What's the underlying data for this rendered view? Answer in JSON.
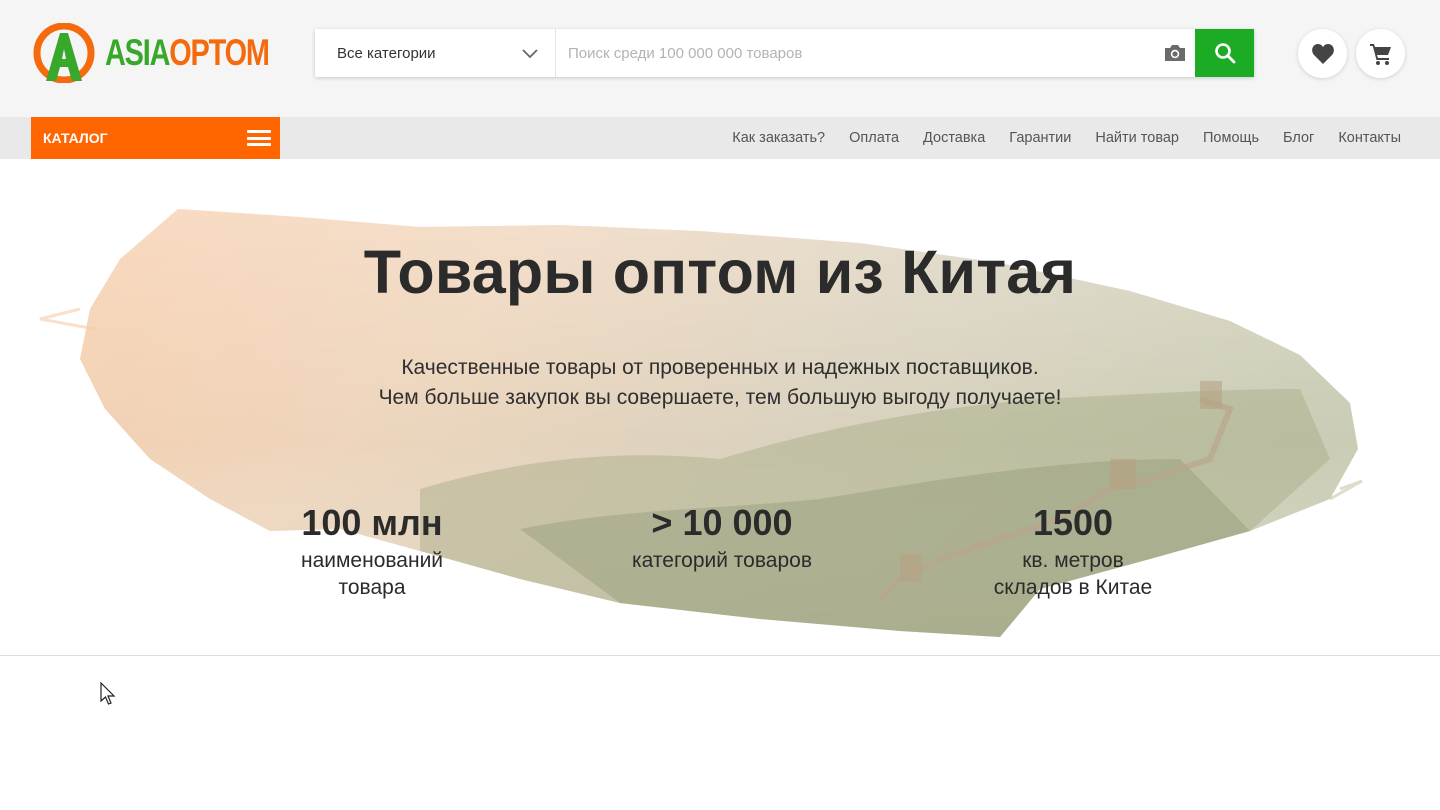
{
  "brand": {
    "part1": "ASIA",
    "part2": "OPTOM",
    "green": "#38a82c",
    "orange": "#f46a0c"
  },
  "search": {
    "category_label": "Все категории",
    "placeholder": "Поиск среди 100 000 000 товаров",
    "button_color": "#1cab24"
  },
  "icons": {
    "camera": "camera-icon",
    "search": "search-icon",
    "favorites": "heart-icon",
    "cart": "shopping-cart-icon",
    "menu": "hamburger-menu-icon",
    "dropdown": "chevron-down-icon"
  },
  "nav": {
    "catalog_label": "КАТАЛОГ",
    "catalog_color": "#ff6600",
    "links": [
      "Как заказать?",
      "Оплата",
      "Доставка",
      "Гарантии",
      "Найти товар",
      "Помощь",
      "Блог",
      "Контакты"
    ]
  },
  "hero": {
    "title": "Товары оптом из Китая",
    "subtitle_line1": "Качественные товары от проверенных и надежных поставщиков.",
    "subtitle_line2": "Чем больше закупок вы совершаете, тем большую выгоду получаете!",
    "stats": [
      {
        "value": "100 млн",
        "caption_line1": "наименований",
        "caption_line2": "товара"
      },
      {
        "value": "> 10 000",
        "caption_line1": "категорий товаров",
        "caption_line2": ""
      },
      {
        "value": "1500",
        "caption_line1": "кв. метров",
        "caption_line2": "складов в Китае"
      }
    ]
  }
}
